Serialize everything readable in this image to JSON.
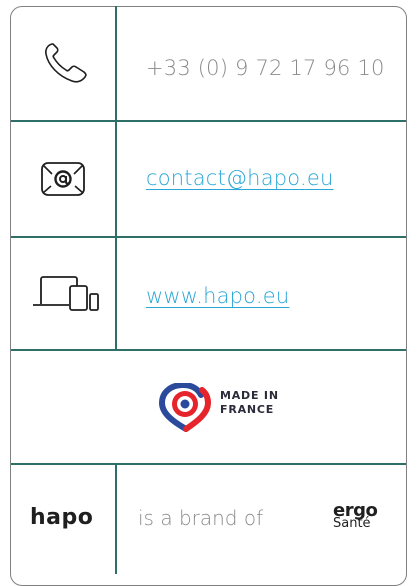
{
  "contact": {
    "phone": "+33 (0) 9 72 17 96 10",
    "email": "contact@hapo.eu",
    "website": "www.hapo.eu"
  },
  "icons": {
    "phone": "phone-icon",
    "email": "email-icon",
    "devices": "devices-icon",
    "location_pin": "location-pin-icon"
  },
  "badge": {
    "line1": "MADE IN",
    "line2": "FRANCE"
  },
  "footer": {
    "hapo_logo": "hapo",
    "brand_text": "is a brand of",
    "ergo_top": "ergo",
    "ergo_bottom": "Santé"
  },
  "colors": {
    "divider": "#2e6f68",
    "border": "#808080",
    "link": "#2aa6d6",
    "text": "#8a8a8a",
    "flag_blue": "#2b4a9b",
    "flag_red": "#e5242b"
  }
}
